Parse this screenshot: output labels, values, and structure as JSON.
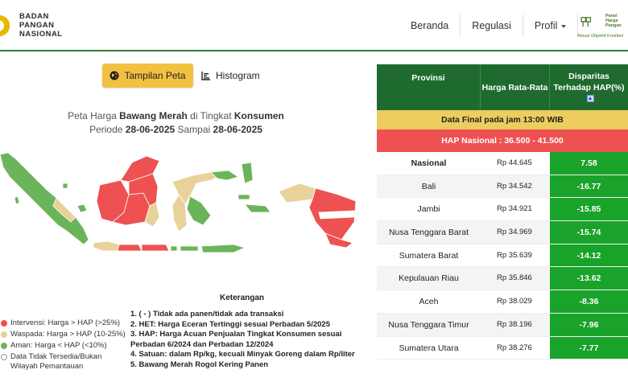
{
  "header": {
    "logo_lines": [
      "BADAN",
      "PANGAN",
      "NASIONAL"
    ],
    "nav": {
      "beranda": "Beranda",
      "regulasi": "Regulasi",
      "profil": "Profil"
    },
    "php_logo_lines": [
      "Panel",
      "Harga",
      "Pangan"
    ],
    "php_tagline": "Aktual Objektif Kredibel"
  },
  "view_toggle": {
    "map_label": "Tampilan Peta",
    "histogram_label": "Histogram"
  },
  "map_title": {
    "prefix": "Peta Harga ",
    "commodity": "Bawang Merah",
    "middle": " di Tingkat ",
    "level": "Konsumen",
    "period_prefix": "Periode ",
    "date_start": "28-06-2025",
    "period_middle": " Sampai ",
    "date_end": "28-06-2025"
  },
  "legend": {
    "items": [
      {
        "label": "Intervensi: Harga > HAP (>25%)",
        "color": "#ee5151"
      },
      {
        "label": "Waspada: Harga > HAP (10-25%)",
        "color": "#e9d29a"
      },
      {
        "label": "Aman: Harga < HAP (<10%)",
        "color": "#6bb45a"
      },
      {
        "label": "Data Tidak Tersedia/Bukan Wilayah Pemantauan",
        "color": "#ffffff"
      }
    ]
  },
  "keterangan": {
    "title": "Keterangan",
    "notes": [
      "1. ( - ) Tidak ada panen/tidak ada transaksi",
      "2. HET: Harga Eceran Tertinggi sesuai Perbadan 5/2025",
      "3. HAP: Harga Acuan Penjualan Tingkat Konsumen sesuai Perbadan 6/2024 dan Perbadan 12/2024",
      "4. Satuan: dalam Rp/kg, kecuali Minyak Goreng dalam Rp/liter",
      "5. Bawang Merah Rogol Kering Panen"
    ]
  },
  "table": {
    "headers": {
      "province": "Provinsi",
      "price": "Harga Rata-Rata",
      "disparity": "Disparitas Terhadap HAP(%)"
    },
    "final_banner": "Data Final pada jam 13:00 WIB",
    "hap_banner": "HAP Nasional : 36.500 - 41.500",
    "rows": [
      {
        "province": "Nasional",
        "price": "Rp 44.645",
        "disparity": "7.58"
      },
      {
        "province": "Bali",
        "price": "Rp 34.542",
        "disparity": "-16.77"
      },
      {
        "province": "Jambi",
        "price": "Rp 34.921",
        "disparity": "-15.85"
      },
      {
        "province": "Nusa Tenggara Barat",
        "price": "Rp 34.969",
        "disparity": "-15.74"
      },
      {
        "province": "Sumatera Barat",
        "price": "Rp 35.639",
        "disparity": "-14.12"
      },
      {
        "province": "Kepulauan Riau",
        "price": "Rp 35.846",
        "disparity": "-13.62"
      },
      {
        "province": "Aceh",
        "price": "Rp 38.029",
        "disparity": "-8.36"
      },
      {
        "province": "Nusa Tenggara Timur",
        "price": "Rp 38.196",
        "disparity": "-7.96"
      },
      {
        "province": "Sumatera Utara",
        "price": "Rp 38.276",
        "disparity": "-7.77"
      }
    ],
    "disparity_color": "#1aa32b"
  }
}
